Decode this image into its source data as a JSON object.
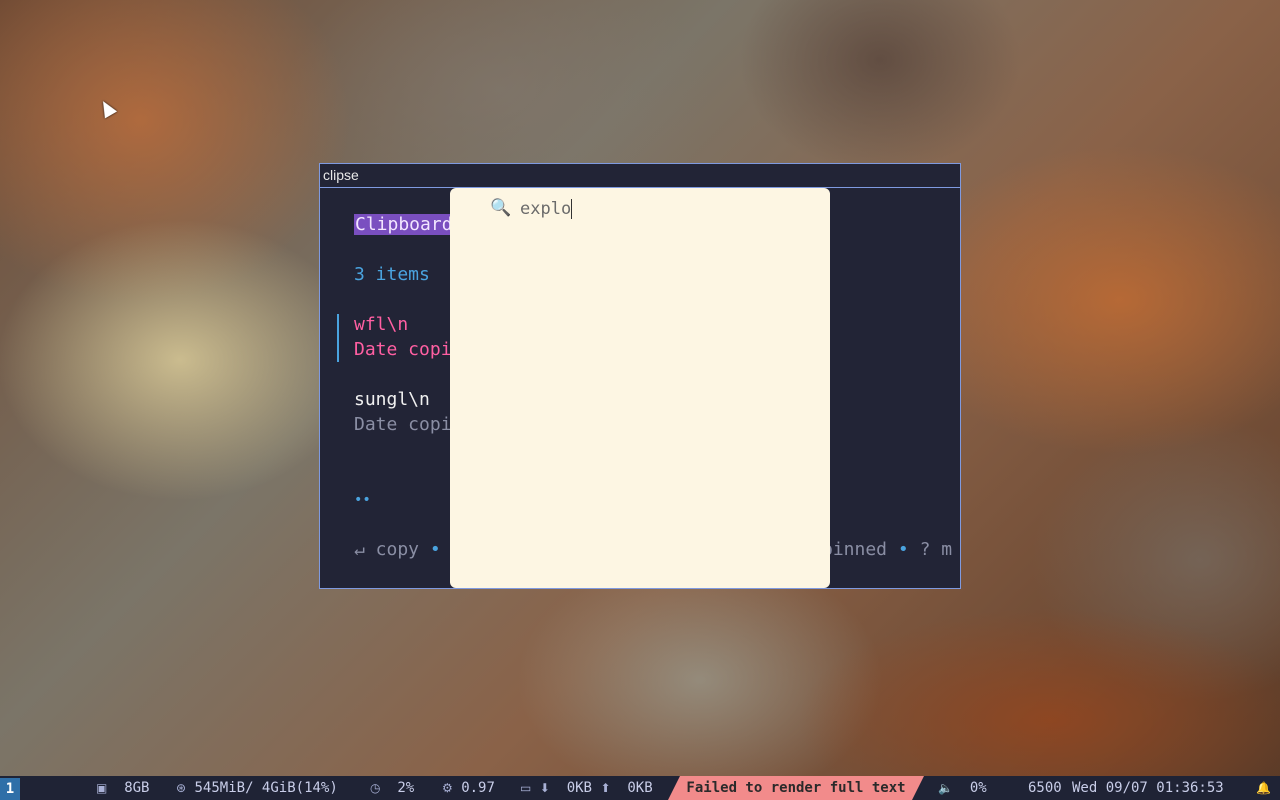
{
  "window": {
    "title": "clipse",
    "header_badge": "Clipboard",
    "item_count": "3 items",
    "items": [
      {
        "text": "wfl\\n",
        "meta": "Date copi",
        "selected": true
      },
      {
        "text": "sungl\\n",
        "meta": "Date copi",
        "selected": false
      }
    ],
    "pager_dots": "••",
    "help": {
      "left": "↵ copy",
      "sep": "•",
      "right": "pinned",
      "sep2": "•",
      "tail": "? m"
    }
  },
  "popup": {
    "search_value": "explo"
  },
  "statusbar": {
    "workspace": "1",
    "disk": "8GB",
    "memory": "545MiB/ 4GiB(14%)",
    "cpu": "2%",
    "load": "0.97",
    "net_up": "0KB",
    "net_down": "0KB",
    "error": "Failed to render full text",
    "volume": "0%",
    "color_temp": "6500",
    "datetime": "Wed 09/07 01:36:53"
  },
  "colors": {
    "window_bg": "#222436",
    "border": "#7f9ae0",
    "badge": "#7a4fc0",
    "accent_blue": "#4aa3df",
    "selected_pink": "#ff5fa2",
    "popup_bg": "#fdf6e3",
    "error_bg": "#f28b8b"
  }
}
